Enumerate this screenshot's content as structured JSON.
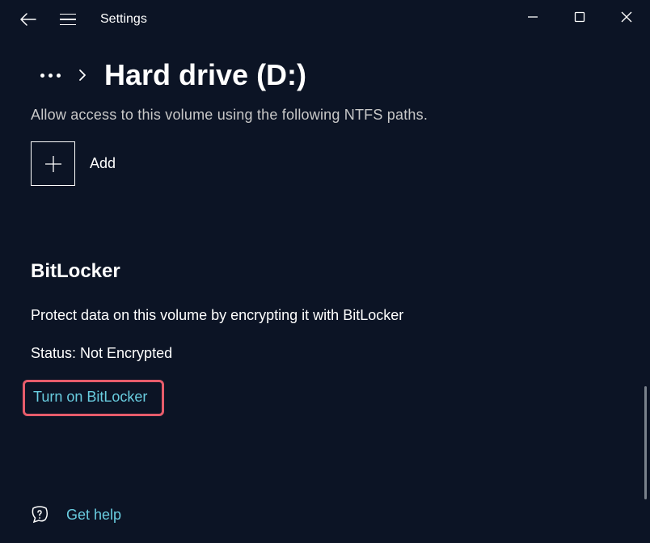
{
  "titlebar": {
    "title": "Settings"
  },
  "breadcrumb": {
    "page_title": "Hard drive (D:)"
  },
  "ntfs": {
    "description": "Allow access to this volume using the following NTFS paths.",
    "add_label": "Add"
  },
  "bitlocker": {
    "heading": "BitLocker",
    "description": "Protect data on this volume by encrypting it with BitLocker",
    "status": "Status: Not Encrypted",
    "turn_on_label": "Turn on BitLocker"
  },
  "help": {
    "label": "Get help"
  }
}
